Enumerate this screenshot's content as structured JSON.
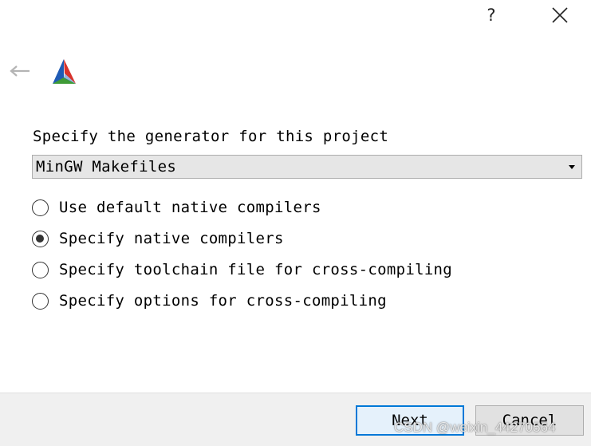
{
  "titlebar": {
    "help_label": "?"
  },
  "header": {
    "back_icon": "back-arrow-icon",
    "logo_icon": "cmake-logo-icon"
  },
  "generator": {
    "prompt": "Specify the generator for this project",
    "selected": "MinGW Makefiles"
  },
  "options": [
    {
      "label": "Use default native compilers",
      "checked": false
    },
    {
      "label": "Specify native compilers",
      "checked": true
    },
    {
      "label": "Specify toolchain file for cross-compiling",
      "checked": false
    },
    {
      "label": "Specify options for cross-compiling",
      "checked": false
    }
  ],
  "buttons": {
    "next": "Next",
    "cancel": "Cancel"
  },
  "watermark": "CSDN @weixin_44270564",
  "colors": {
    "accent": "#0078d7",
    "logo_blue": "#1f5bb5",
    "logo_red": "#d8322c",
    "logo_green": "#3f9b37"
  }
}
